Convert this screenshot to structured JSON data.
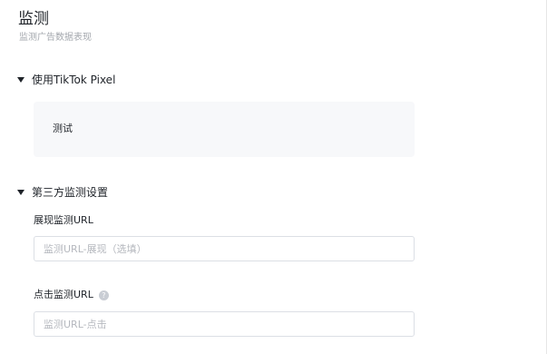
{
  "header": {
    "title": "监测",
    "subtitle": "监测广告数据表现"
  },
  "tiktok_pixel": {
    "section_label": "使用TikTok Pixel",
    "expanded": true,
    "pixel_name": "测试"
  },
  "third_party": {
    "section_label": "第三方监测设置",
    "expanded": true,
    "impression_url": {
      "label": "展现监测URL",
      "value": "",
      "placeholder": "监测URL-展现（选填）"
    },
    "click_url": {
      "label": "点击监测URL",
      "value": "",
      "placeholder": "监测URL-点击",
      "help_icon": "question-circle-icon"
    }
  }
}
